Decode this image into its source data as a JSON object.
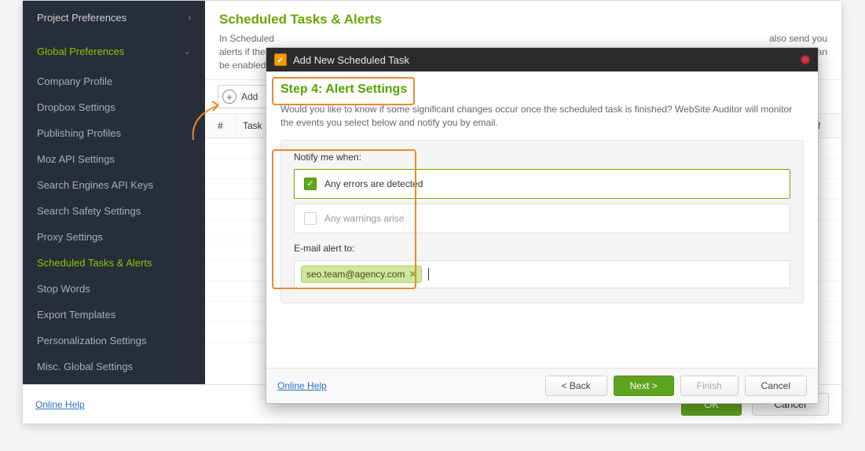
{
  "sidebar": {
    "project_section": "Project Preferences",
    "global_section": "Global Preferences",
    "items": [
      "Company Profile",
      "Dropbox Settings",
      "Publishing Profiles",
      "Moz API Settings",
      "Search Engines API Keys",
      "Search Safety Settings",
      "Proxy Settings",
      "Scheduled Tasks & Alerts",
      "Stop Words",
      "Export Templates",
      "Personalization Settings",
      "Misc. Global Settings"
    ],
    "active_index": 7
  },
  "main": {
    "title": "Scheduled Tasks & Alerts",
    "desc_line1": "In Scheduled",
    "desc_line2": "alerts if there",
    "desc_line3": "be enabled",
    "desc_right1": "also send you",
    "desc_right2": "ones. Alerts can",
    "add_label": "Add",
    "col_num": "#",
    "col_taskname": "Task Name",
    "col_onoff": "On/Off"
  },
  "footer": {
    "help": "Online Help",
    "ok": "OK",
    "cancel": "Cancel"
  },
  "modal": {
    "title": "Add New Scheduled Task",
    "step_title": "Step 4: Alert Settings",
    "step_desc": "Would you like to know if some significant changes occur once the scheduled task is finished? WebSite Auditor will monitor the events you select below and notify you by email.",
    "notify_label": "Notify me when:",
    "chk_errors": "Any errors are detected",
    "chk_warnings": "Any warnings arise",
    "email_label": "E-mail alert to:",
    "email_tag": "seo.team@agency.com",
    "help": "Online Help",
    "back": "< Back",
    "next": "Next >",
    "finish": "Finish",
    "cancel": "Cancel"
  }
}
